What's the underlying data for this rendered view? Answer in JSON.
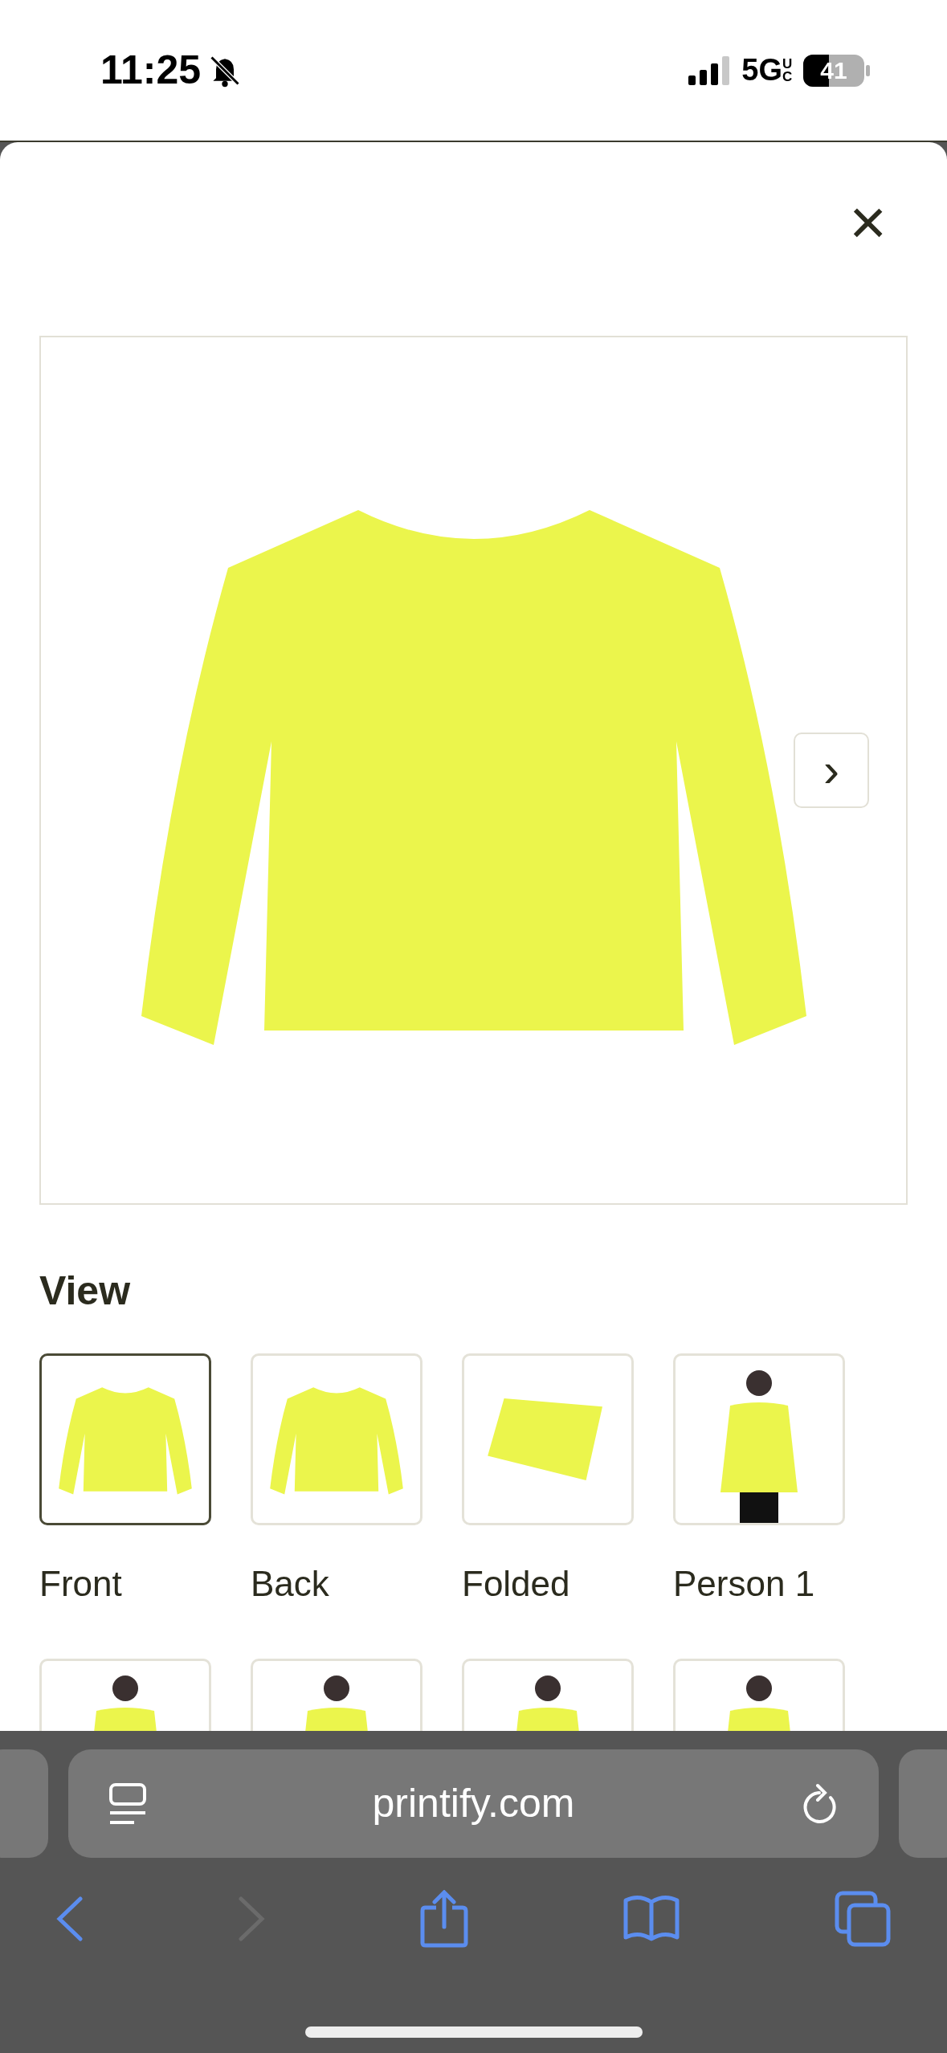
{
  "status_bar": {
    "time": "11:25",
    "network": "5G",
    "network_sub": "UC",
    "battery": "41"
  },
  "dialog": {
    "close": "×",
    "next": "›",
    "section_title": "View",
    "thumbnails": [
      {
        "label": "Front",
        "kind": "garment",
        "selected": true
      },
      {
        "label": "Back",
        "kind": "garment",
        "selected": false
      },
      {
        "label": "Folded",
        "kind": "folded",
        "selected": false
      },
      {
        "label": "Person 1",
        "kind": "person",
        "selected": false
      },
      {
        "kind": "person",
        "selected": false
      },
      {
        "kind": "person",
        "selected": false
      },
      {
        "kind": "person",
        "selected": false
      },
      {
        "kind": "person",
        "selected": false
      }
    ]
  },
  "browser": {
    "url": "printify.com"
  }
}
